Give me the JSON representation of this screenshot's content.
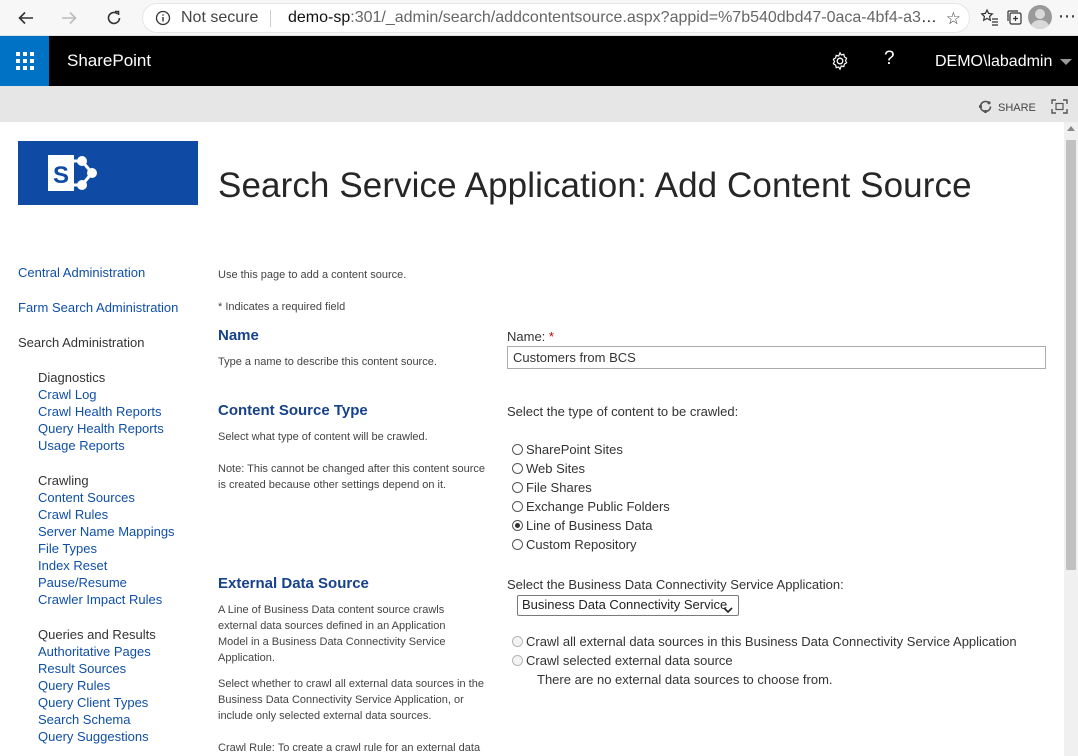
{
  "browser": {
    "security": "Not secure",
    "url_host": "demo-sp",
    "url_rest": ":301/_admin/search/addcontentsource.aspx?appid=%7b540dbd47-0aca-4bf4-a38..."
  },
  "suite": {
    "title": "SharePoint",
    "user": "DEMO\\labadmin",
    "help": "?"
  },
  "ribbon": {
    "share": "SHARE"
  },
  "page": {
    "title": "Search Service Application: Add Content Source"
  },
  "leftnav": {
    "top_links": [
      "Central Administration",
      "Farm Search Administration",
      "Search Administration"
    ],
    "groups": [
      {
        "heading": "Diagnostics",
        "links": [
          "Crawl Log",
          "Crawl Health Reports",
          "Query Health Reports",
          "Usage Reports"
        ]
      },
      {
        "heading": "Crawling",
        "links": [
          "Content Sources",
          "Crawl Rules",
          "Server Name Mappings",
          "File Types",
          "Index Reset",
          "Pause/Resume",
          "Crawler Impact Rules"
        ]
      },
      {
        "heading": "Queries and Results",
        "links": [
          "Authoritative Pages",
          "Result Sources",
          "Query Rules",
          "Query Client Types",
          "Search Schema",
          "Query Suggestions"
        ]
      }
    ]
  },
  "intro": {
    "text": "Use this page to add a content source.",
    "required": "* Indicates a required field"
  },
  "name_section": {
    "heading": "Name",
    "desc": "Type a name to describe this content source.",
    "label": "Name:",
    "required_mark": "*",
    "value": "Customers from BCS"
  },
  "type_section": {
    "heading": "Content Source Type",
    "desc": "Select what type of content will be crawled.",
    "note": "Note: This cannot be changed after this content source is created because other settings depend on it.",
    "prompt": "Select the type of content to be crawled:",
    "options": [
      "SharePoint Sites",
      "Web Sites",
      "File Shares",
      "Exchange Public Folders",
      "Line of Business Data",
      "Custom Repository"
    ],
    "selected_index": 4
  },
  "external_section": {
    "heading": "External Data Source",
    "desc1": "A Line of Business Data content source crawls external data sources defined in an Application Model in a Business Data Connectivity Service Application.",
    "desc2": "Select whether to crawl all external data sources in the Business Data Connectivity Service Application, or include only selected external data sources.",
    "desc3": "Crawl Rule: To create a crawl rule for an external data",
    "prompt": "Select the Business Data Connectivity Service Application:",
    "select_value": "Business Data Connectivity Service",
    "options": [
      "Crawl all external data sources in this Business Data Connectivity Service Application",
      "Crawl selected external data source"
    ],
    "empty_msg": "There are no external data sources to choose from."
  }
}
